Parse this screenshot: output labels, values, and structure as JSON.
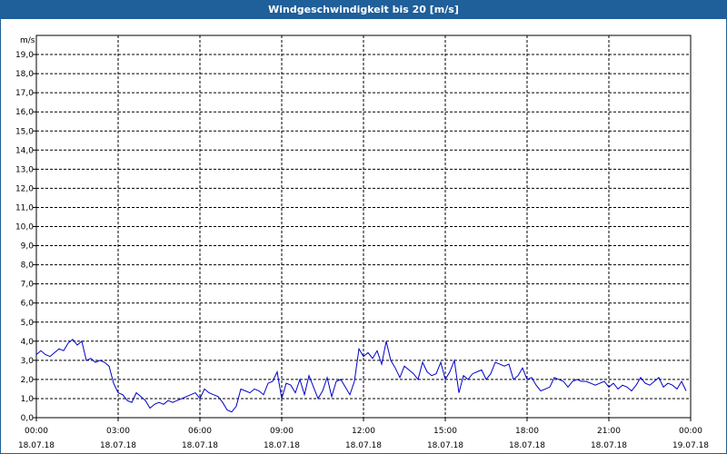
{
  "window": {
    "title": "Windgeschwindigkeit bis 20 [m/s]"
  },
  "colors": {
    "titlebar": "#1f5f9a",
    "line": "#0000c8",
    "grid": "#000000"
  },
  "chart_data": {
    "type": "line",
    "title": "Windgeschwindigkeit bis 20 [m/s]",
    "ylabel": "m/s",
    "xlabel": "",
    "ylim": [
      0,
      20
    ],
    "yticks": [
      "0,0",
      "1,0",
      "2,0",
      "3,0",
      "4,0",
      "5,0",
      "6,0",
      "7,0",
      "8,0",
      "9,0",
      "10,0",
      "11,0",
      "12,0",
      "13,0",
      "14,0",
      "15,0",
      "16,0",
      "17,0",
      "18,0",
      "19,0"
    ],
    "xlim_hours": [
      0,
      24
    ],
    "xticks": [
      {
        "time": "00:00",
        "date": "18.07.18"
      },
      {
        "time": "03:00",
        "date": "18.07.18"
      },
      {
        "time": "06:00",
        "date": "18.07.18"
      },
      {
        "time": "09:00",
        "date": "18.07.18"
      },
      {
        "time": "12:00",
        "date": "18.07.18"
      },
      {
        "time": "15:00",
        "date": "18.07.18"
      },
      {
        "time": "18:00",
        "date": "18.07.18"
      },
      {
        "time": "21:00",
        "date": "18.07.18"
      },
      {
        "time": "00:00",
        "date": "19.07.18"
      }
    ],
    "grid": true,
    "series": [
      {
        "x": [
          "00:00",
          "00:10",
          "00:20",
          "00:30",
          "00:40",
          "00:50",
          "01:00",
          "01:10",
          "01:20",
          "01:30",
          "01:40",
          "01:50",
          "02:00",
          "02:10",
          "02:20",
          "02:30",
          "02:40",
          "02:50",
          "03:00",
          "03:10",
          "03:20",
          "03:30",
          "03:40",
          "03:50",
          "04:00",
          "04:10",
          "04:20",
          "04:30",
          "04:40",
          "04:50",
          "05:00",
          "05:10",
          "05:20",
          "05:30",
          "05:40",
          "05:50",
          "06:00",
          "06:10",
          "06:20",
          "06:30",
          "06:40",
          "06:50",
          "07:00",
          "07:10",
          "07:20",
          "07:30",
          "07:40",
          "07:50",
          "08:00",
          "08:10",
          "08:20",
          "08:30",
          "08:40",
          "08:50",
          "09:00",
          "09:10",
          "09:20",
          "09:30",
          "09:40",
          "09:50",
          "10:00",
          "10:10",
          "10:20",
          "10:30",
          "10:40",
          "10:50",
          "11:00",
          "11:10",
          "11:20",
          "11:30",
          "11:40",
          "11:50",
          "12:00",
          "12:10",
          "12:20",
          "12:30",
          "12:40",
          "12:50",
          "13:00",
          "13:10",
          "13:20",
          "13:30",
          "13:40",
          "13:50",
          "14:00",
          "14:10",
          "14:20",
          "14:30",
          "14:40",
          "14:50",
          "15:00",
          "15:10",
          "15:20",
          "15:30",
          "15:40",
          "15:50",
          "16:00",
          "16:10",
          "16:20",
          "16:30",
          "16:40",
          "16:50",
          "17:00",
          "17:10",
          "17:20",
          "17:30",
          "17:40",
          "17:50",
          "18:00",
          "18:10",
          "18:20",
          "18:30",
          "18:40",
          "18:50",
          "19:00",
          "19:10",
          "19:20",
          "19:30",
          "19:40",
          "19:50",
          "20:00",
          "20:10",
          "20:20",
          "20:30",
          "20:40",
          "20:50",
          "21:00",
          "21:10",
          "21:20",
          "21:30",
          "21:40",
          "21:50",
          "22:00",
          "22:10",
          "22:20",
          "22:30",
          "22:40",
          "22:50",
          "23:00",
          "23:10",
          "23:20",
          "23:30",
          "23:40",
          "23:50"
        ],
        "values": [
          3.3,
          3.5,
          3.3,
          3.2,
          3.4,
          3.6,
          3.5,
          3.9,
          4.1,
          3.8,
          4.0,
          3.0,
          3.1,
          2.9,
          3.0,
          2.9,
          2.7,
          1.8,
          1.3,
          1.2,
          0.9,
          0.8,
          1.3,
          1.1,
          0.9,
          0.5,
          0.7,
          0.8,
          0.7,
          0.9,
          0.8,
          0.9,
          1.0,
          1.1,
          1.2,
          1.3,
          1.0,
          1.5,
          1.3,
          1.2,
          1.1,
          0.8,
          0.4,
          0.3,
          0.6,
          1.5,
          1.4,
          1.3,
          1.5,
          1.4,
          1.2,
          1.8,
          1.9,
          2.4,
          1.0,
          1.8,
          1.7,
          1.3,
          2.0,
          1.2,
          2.2,
          1.6,
          1.0,
          1.4,
          2.1,
          1.1,
          1.9,
          2.0,
          1.6,
          1.2,
          1.9,
          3.6,
          3.2,
          3.4,
          3.1,
          3.5,
          2.8,
          4.0,
          3.0,
          2.6,
          2.1,
          2.7,
          2.5,
          2.3,
          2.0,
          2.9,
          2.4,
          2.2,
          2.3,
          2.9,
          2.0,
          2.4,
          3.0,
          1.3,
          2.2,
          2.0,
          2.3,
          2.4,
          2.5,
          2.0,
          2.3,
          2.9,
          2.8,
          2.7,
          2.8,
          2.0,
          2.2,
          2.6,
          2.0,
          2.1,
          1.7,
          1.4,
          1.5,
          1.6,
          2.1,
          2.0,
          1.9,
          1.6,
          1.9,
          2.0,
          1.9,
          1.9,
          1.8,
          1.7,
          1.8,
          1.9,
          1.6,
          1.8,
          1.5,
          1.7,
          1.6,
          1.4,
          1.7,
          2.1,
          1.8,
          1.7,
          1.9,
          2.1,
          1.6,
          1.8,
          1.7,
          1.5,
          1.9,
          1.4
        ]
      }
    ]
  }
}
